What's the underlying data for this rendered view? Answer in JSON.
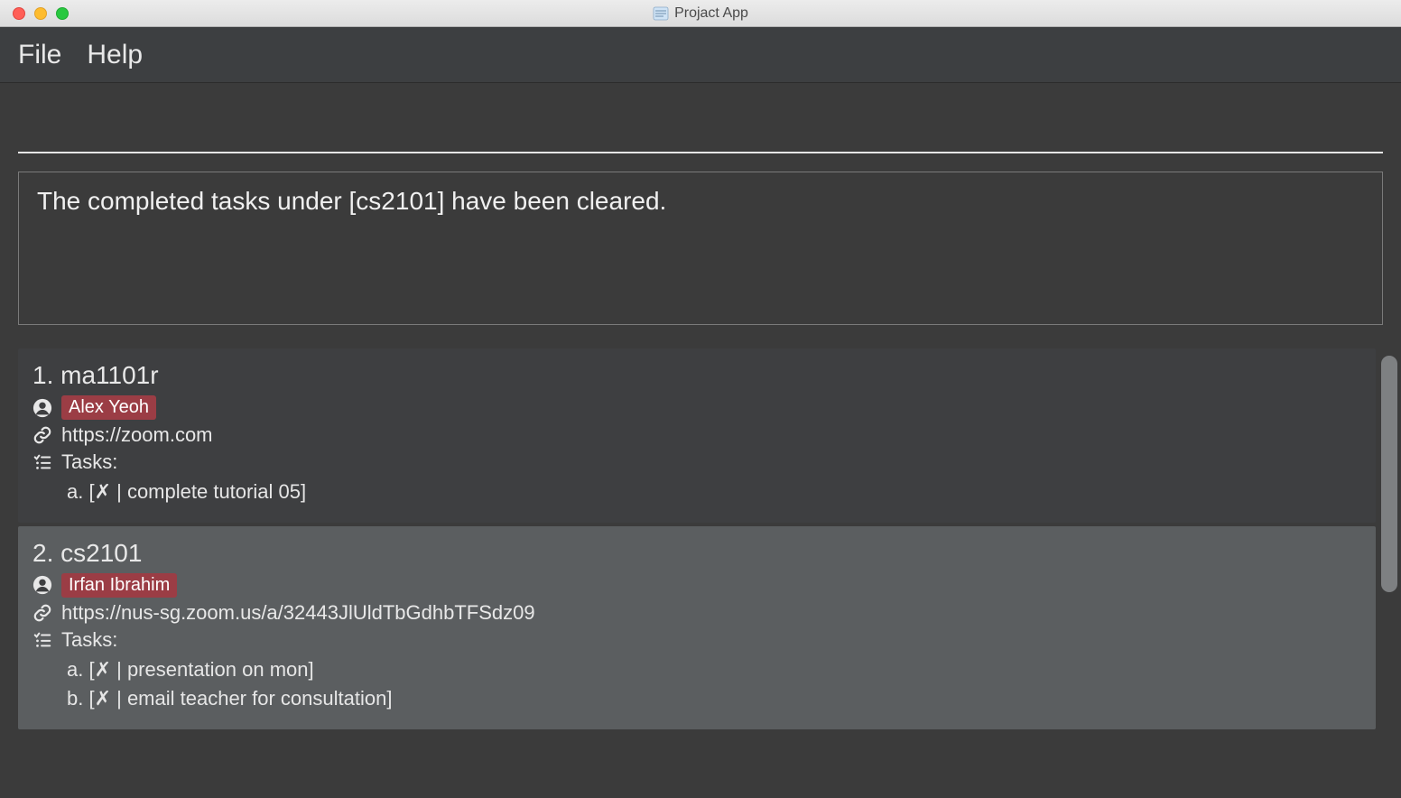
{
  "window": {
    "title": "Projact App"
  },
  "menu": {
    "file": "File",
    "help": "Help"
  },
  "command": {
    "value": ""
  },
  "result": {
    "message": "The completed tasks under [cs2101] have been cleared."
  },
  "projects": [
    {
      "index": "1.",
      "name": "ma1101r",
      "people": [
        "Alex Yeoh"
      ],
      "link": "https://zoom.com",
      "tasks_label": "Tasks:",
      "tasks": [
        "a. [✗ | complete tutorial 05]"
      ]
    },
    {
      "index": "2.",
      "name": "cs2101",
      "people": [
        "Irfan Ibrahim"
      ],
      "link": "https://nus-sg.zoom.us/a/32443JlUldTbGdhbTFSdz09",
      "tasks_label": "Tasks:",
      "tasks": [
        "a. [✗ | presentation on mon]",
        "b. [✗ | email teacher for consultation]"
      ]
    }
  ]
}
